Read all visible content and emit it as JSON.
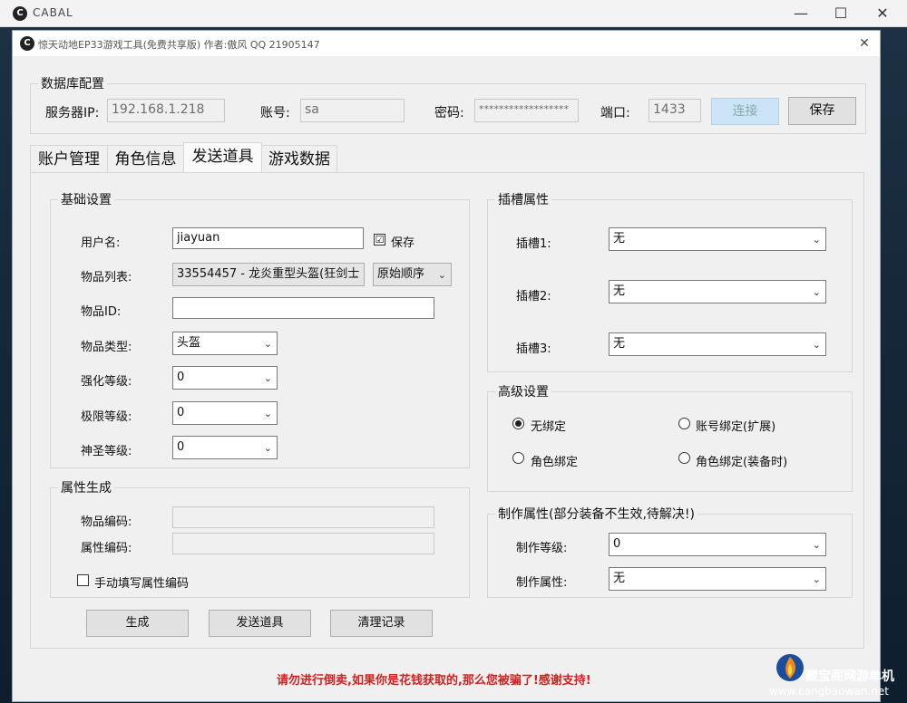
{
  "outer_window": {
    "title": "CABAL",
    "logo": "C",
    "minimize": "—",
    "maximize": "☐",
    "close": "✕"
  },
  "tool_window": {
    "title": "惊天动地EP33游戏工具(免费共享版) 作者:傲风 QQ 21905147",
    "logo": "C",
    "close": "✕"
  },
  "db": {
    "group_label": "数据库配置",
    "server_label": "服务器IP:",
    "server_value": "192.168.1.218",
    "account_label": "账号:",
    "account_value": "sa",
    "password_label": "密码:",
    "password_value": "******************",
    "port_label": "端口:",
    "port_value": "1433",
    "connect_button": "连接",
    "save_button": "保存"
  },
  "tabs": [
    "账户管理",
    "角色信息",
    "发送道具",
    "游戏数据"
  ],
  "basic": {
    "group_label": "基础设置",
    "username_label": "用户名:",
    "username_value": "jiayuan",
    "save_checkbox_label": "保存",
    "save_checked": "☑",
    "itemlist_label": "物品列表:",
    "itemlist_value": "33554457 - 龙炎重型头盔(狂剑士",
    "order_value": "原始顺序",
    "itemid_label": "物品ID:",
    "itemid_value": "",
    "itemtype_label": "物品类型:",
    "itemtype_value": "头盔",
    "enhance_label": "强化等级:",
    "enhance_value": "0",
    "limit_label": "极限等级:",
    "limit_value": "0",
    "holy_label": "神圣等级:",
    "holy_value": "0"
  },
  "attr": {
    "group_label": "属性生成",
    "item_code_label": "物品编码:",
    "attr_code_label": "属性编码:",
    "manual_label": "手动填写属性编码"
  },
  "actions": {
    "generate": "生成",
    "send": "发送道具",
    "clear": "清理记录"
  },
  "slots": {
    "group_label": "插槽属性",
    "slot1_label": "插槽1:",
    "slot1_value": "无",
    "slot2_label": "插槽2:",
    "slot2_value": "无",
    "slot3_label": "插槽3:",
    "slot3_value": "无"
  },
  "advanced": {
    "group_label": "高级设置",
    "opt_nobind": "无绑定",
    "opt_account_bind": "账号绑定(扩展)",
    "opt_char_bind": "角色绑定",
    "opt_char_bind_equip": "角色绑定(装备时)"
  },
  "craft": {
    "group_label": "制作属性(部分装备不生效,待解决!)",
    "level_label": "制作等级:",
    "level_value": "0",
    "attr_label": "制作属性:",
    "attr_value": "无"
  },
  "warning": "请勿进行倒卖,如果你是花钱获取的,那么您被骗了!感谢支持!",
  "watermark": {
    "name": "藏宝阁网游单机",
    "url": "www.cangbaowan.net"
  },
  "colors": {
    "warning": "#d21f1f",
    "disabled_button": "#cce4f7"
  }
}
